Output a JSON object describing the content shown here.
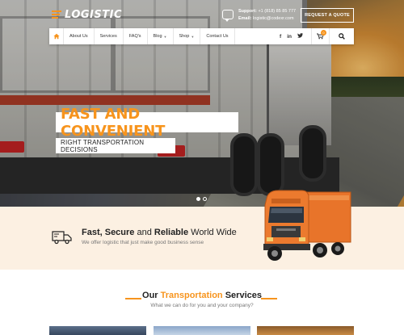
{
  "header": {
    "logo_text": "LOGISTIC",
    "support_label": "Support:",
    "support_phone": "+1 (818) 85 85 777",
    "email_label": "Email:",
    "email_value": "logistic@codexr.com",
    "quote_button": "REQUEST A QUOTE"
  },
  "nav": {
    "items": [
      {
        "label": "About Us",
        "dropdown": false
      },
      {
        "label": "Services",
        "dropdown": false
      },
      {
        "label": "FAQ's",
        "dropdown": false
      },
      {
        "label": "Blog",
        "dropdown": true
      },
      {
        "label": "Shop",
        "dropdown": true
      },
      {
        "label": "Contact Us",
        "dropdown": false
      }
    ],
    "social": {
      "facebook": "f",
      "linkedin": "in",
      "twitter": "t"
    },
    "cart_count": "0"
  },
  "hero": {
    "headline": "FAST AND CONVENIENT",
    "subline": "RIGHT TRANSPORTATION DECISIONS",
    "slides": 2,
    "active_slide": 1
  },
  "band": {
    "title_parts": [
      "Fast, Secure",
      " and ",
      "Reliable",
      " World Wide"
    ],
    "subtitle": "We offer logistic that just make good business sense"
  },
  "services": {
    "title_prefix": "Our ",
    "title_highlight": "Transportation",
    "title_suffix": " Services",
    "subtitle": "What we can do for you and your company?"
  },
  "colors": {
    "accent": "#f7941d",
    "band_bg": "#fcf0e2",
    "text_dark": "#222222",
    "text_muted": "#777777"
  }
}
